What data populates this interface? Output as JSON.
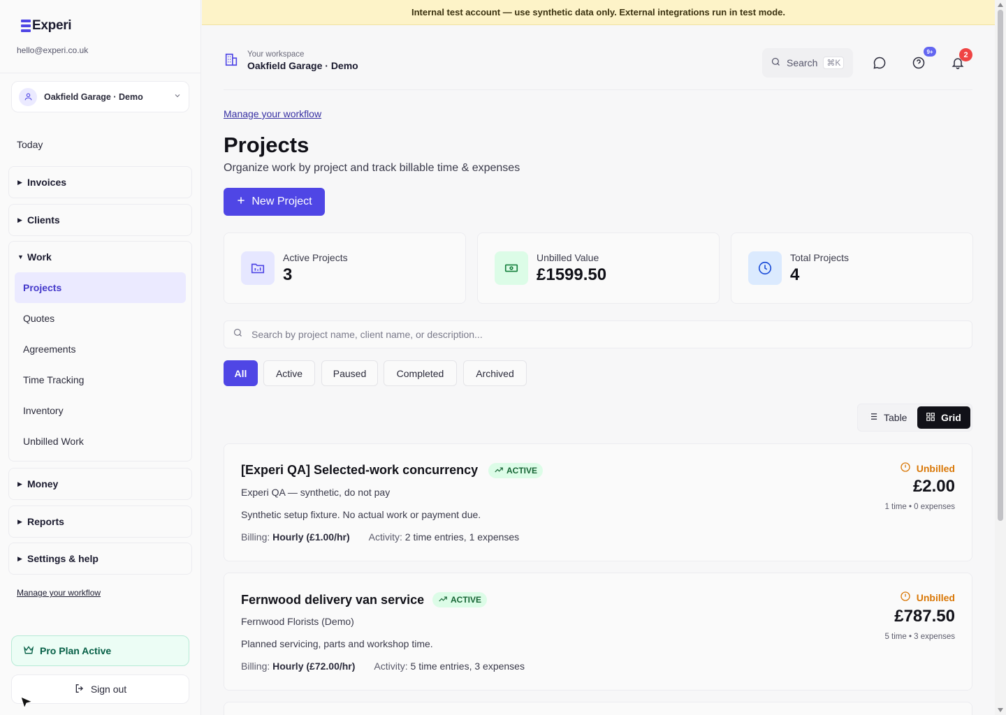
{
  "brand": {
    "name": "Experi",
    "email": "hello@experi.co.uk"
  },
  "workspace_select": {
    "name": "Oakfield Garage · Demo"
  },
  "sidebar": {
    "today": "Today",
    "groups": {
      "invoices": "Invoices",
      "clients": "Clients",
      "work": "Work",
      "money": "Money",
      "reports": "Reports",
      "settings": "Settings & help"
    },
    "work_items": [
      "Projects",
      "Quotes",
      "Agreements",
      "Time Tracking",
      "Inventory",
      "Unbilled Work"
    ],
    "workflow_link": "Manage your workflow",
    "pro_plan": "Pro Plan Active",
    "sign_out": "Sign out"
  },
  "banner": "Internal test account — use synthetic data only. External integrations run in test mode.",
  "header": {
    "workspace_label": "Your workspace",
    "workspace_name": "Oakfield Garage · Demo",
    "search_label": "Search",
    "search_shortcut": "⌘K",
    "help_badge": "9+",
    "notification_badge": "2"
  },
  "page": {
    "breadcrumb": "Manage your workflow",
    "title": "Projects",
    "subtitle": "Organize work by project and track billable time & expenses",
    "new_project": "New Project"
  },
  "stats": [
    {
      "label": "Active Projects",
      "value": "3"
    },
    {
      "label": "Unbilled Value",
      "value": "£1599.50"
    },
    {
      "label": "Total Projects",
      "value": "4"
    }
  ],
  "search": {
    "placeholder": "Search by project name, client name, or description..."
  },
  "filters": [
    "All",
    "Active",
    "Paused",
    "Completed",
    "Archived"
  ],
  "view_toggle": {
    "table": "Table",
    "grid": "Grid"
  },
  "projects": [
    {
      "title": "[Experi QA] Selected-work concurrency",
      "status": "ACTIVE",
      "client": "Experi QA — synthetic, do not pay",
      "description": "Synthetic setup fixture. No actual work or payment due.",
      "billing_label": "Billing:",
      "billing_value": "Hourly (£1.00/hr)",
      "activity_label": "Activity:",
      "activity_value": "2 time entries, 1 expenses",
      "unbilled_label": "Unbilled",
      "unbilled_amount": "£2.00",
      "unbilled_breakdown": "1 time • 0 expenses"
    },
    {
      "title": "Fernwood delivery van service",
      "status": "ACTIVE",
      "client": "Fernwood Florists (Demo)",
      "description": "Planned servicing, parts and workshop time.",
      "billing_label": "Billing:",
      "billing_value": "Hourly (£72.00/hr)",
      "activity_label": "Activity:",
      "activity_value": "5 time entries, 3 expenses",
      "unbilled_label": "Unbilled",
      "unbilled_amount": "£787.50",
      "unbilled_breakdown": "5 time • 3 expenses"
    }
  ],
  "colors": {
    "accent": "#4f46e5",
    "banner": "#fdf3c8",
    "success": "#166534",
    "warning": "#d97706"
  }
}
